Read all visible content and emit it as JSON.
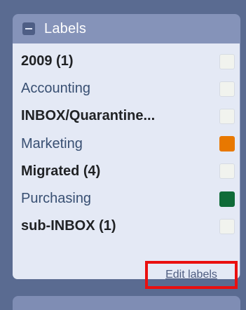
{
  "labels_panel": {
    "title": "Labels",
    "items": [
      {
        "name": "2009 (1)",
        "bold": true,
        "color": "#f1f3ee"
      },
      {
        "name": "Accounting",
        "bold": false,
        "color": "#f1f3ee"
      },
      {
        "name": "INBOX/Quarantine...",
        "bold": true,
        "color": "#f1f3ee"
      },
      {
        "name": "Marketing",
        "bold": false,
        "color": "#e87800"
      },
      {
        "name": "Migrated (4)",
        "bold": true,
        "color": "#f1f3ee"
      },
      {
        "name": "Purchasing",
        "bold": false,
        "color": "#0f6b38"
      },
      {
        "name": "sub-INBOX (1)",
        "bold": true,
        "color": "#f1f3ee"
      }
    ],
    "edit_label": "Edit labels",
    "highlight_color": "#ea0f0f"
  }
}
